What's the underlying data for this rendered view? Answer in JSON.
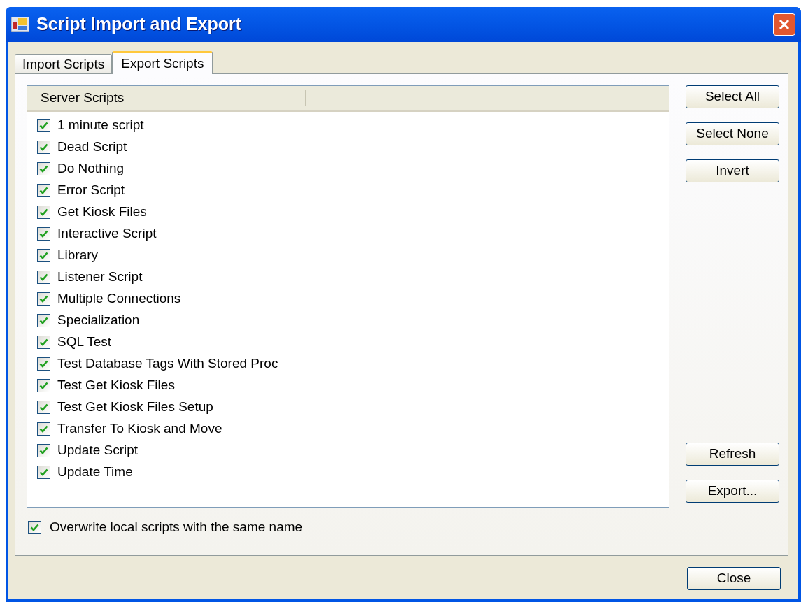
{
  "window": {
    "title": "Script Import and Export"
  },
  "tabs": [
    {
      "label": "Import Scripts",
      "selected": false
    },
    {
      "label": "Export Scripts",
      "selected": true
    }
  ],
  "list": {
    "columns": [
      "Server Scripts"
    ],
    "items": [
      {
        "label": "1 minute script",
        "checked": true
      },
      {
        "label": "Dead Script",
        "checked": true
      },
      {
        "label": "Do Nothing",
        "checked": true
      },
      {
        "label": "Error Script",
        "checked": true
      },
      {
        "label": "Get Kiosk Files",
        "checked": true
      },
      {
        "label": "Interactive Script",
        "checked": true
      },
      {
        "label": "Library",
        "checked": true
      },
      {
        "label": "Listener Script",
        "checked": true
      },
      {
        "label": "Multiple Connections",
        "checked": true
      },
      {
        "label": "Specialization",
        "checked": true
      },
      {
        "label": "SQL Test",
        "checked": true
      },
      {
        "label": "Test Database Tags With Stored Proc",
        "checked": true
      },
      {
        "label": "Test Get Kiosk Files",
        "checked": true
      },
      {
        "label": "Test Get Kiosk Files Setup",
        "checked": true
      },
      {
        "label": "Transfer To Kiosk and Move",
        "checked": true
      },
      {
        "label": "Update Script",
        "checked": true
      },
      {
        "label": "Update Time",
        "checked": true
      }
    ]
  },
  "top_buttons": [
    "Select All",
    "Select None",
    "Invert"
  ],
  "bottom_buttons": [
    "Refresh",
    "Export..."
  ],
  "overwrite": {
    "label": "Overwrite local scripts with the same name",
    "checked": true
  },
  "footer_button": "Close"
}
